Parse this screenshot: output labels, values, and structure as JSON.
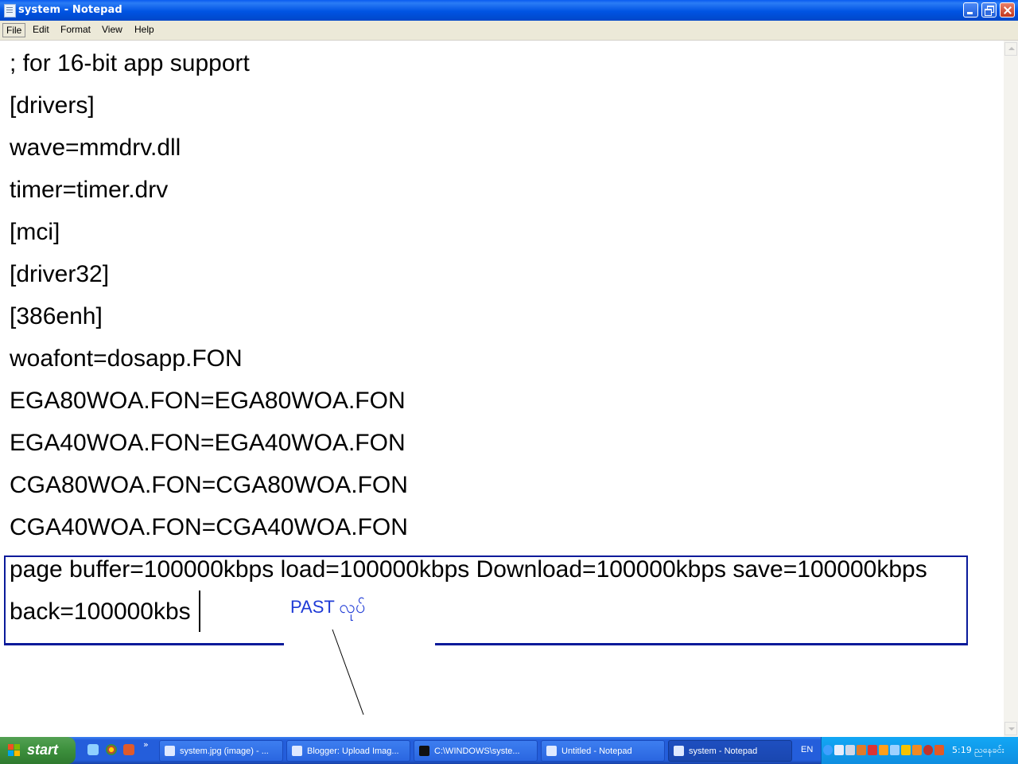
{
  "window": {
    "title": "system - Notepad"
  },
  "menu": [
    "File",
    "Edit",
    "Format",
    "View",
    "Help"
  ],
  "editor": {
    "lines": [
      "; for 16-bit app support",
      "[drivers]",
      "wave=mmdrv.dll",
      "timer=timer.drv",
      "[mci]",
      "[driver32]",
      "[386enh]",
      "woafont=dosapp.FON",
      "EGA80WOA.FON=EGA80WOA.FON",
      "EGA40WOA.FON=EGA40WOA.FON",
      "CGA80WOA.FON=CGA80WOA.FON",
      "CGA40WOA.FON=CGA40WOA.FON",
      "page buffer=100000kbps load=100000kbps Download=100000kbps save=100000kbps",
      "back=100000kbs"
    ]
  },
  "annotation": {
    "text": "PAST လုပ်",
    "color": "#0a1a9a"
  },
  "taskbar": {
    "start_label": "start",
    "quicklaunch_more": "»",
    "tasks": [
      {
        "label": "system.jpg (image) - ...",
        "icon": "ie-icon"
      },
      {
        "label": "Blogger: Upload Imag...",
        "icon": "ie-icon"
      },
      {
        "label": "C:\\WINDOWS\\syste...",
        "icon": "cmd-icon"
      },
      {
        "label": "Untitled - Notepad",
        "icon": "notepad-icon"
      },
      {
        "label": "system - Notepad",
        "icon": "notepad-icon",
        "active": true
      }
    ],
    "lang": "EN",
    "clock": "5:19 ညနေခင်း"
  }
}
